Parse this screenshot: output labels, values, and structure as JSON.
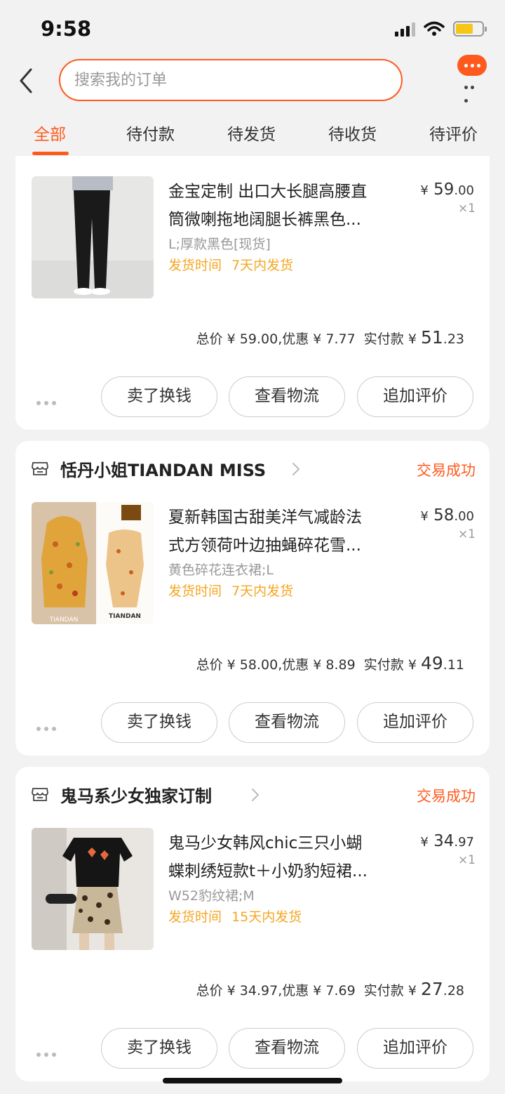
{
  "status_bar": {
    "time": "9:58"
  },
  "header": {
    "search_placeholder": "搜索我的订单",
    "tabs": [
      {
        "label": "全部",
        "active": true
      },
      {
        "label": "待付款",
        "active": false
      },
      {
        "label": "待发货",
        "active": false
      },
      {
        "label": "待收货",
        "active": false
      },
      {
        "label": "待评价",
        "active": false
      }
    ]
  },
  "orders": [
    {
      "shop_name": "",
      "status": "",
      "item": {
        "title_line1": "金宝定制 出口大长腿高腰直",
        "title_line2": "筒微喇拖地阔腿长裤黑色...",
        "sku": "L;厚款黑色[现货]",
        "ship_label": "发货时间",
        "ship_value": "7天内发货",
        "price_currency": "¥",
        "price_int": "59",
        "price_dec": ".00",
        "qty": "×1"
      },
      "summary": {
        "prefix": "总价 ¥ 59.00,优惠 ¥ 7.77",
        "paid_label": "实付款",
        "paid_currency": "¥",
        "paid_int": "51",
        "paid_dec": ".23"
      },
      "buttons": [
        "卖了换钱",
        "查看物流",
        "追加评价"
      ]
    },
    {
      "shop_name": "恬丹小姐TIANDAN MISS",
      "status": "交易成功",
      "item": {
        "title_line1": "夏新韩国古甜美洋气减龄法",
        "title_line2": "式方领荷叶边抽蝇碎花雪...",
        "sku": "黄色碎花连衣裙;L",
        "ship_label": "发货时间",
        "ship_value": "7天内发货",
        "price_currency": "¥",
        "price_int": "58",
        "price_dec": ".00",
        "qty": "×1"
      },
      "summary": {
        "prefix": "总价 ¥ 58.00,优惠 ¥ 8.89",
        "paid_label": "实付款",
        "paid_currency": "¥",
        "paid_int": "49",
        "paid_dec": ".11"
      },
      "buttons": [
        "卖了换钱",
        "查看物流",
        "追加评价"
      ],
      "thumb_text": [
        "TIANDAN",
        "TIANDAN"
      ]
    },
    {
      "shop_name": "鬼马系少女独家订制",
      "status": "交易成功",
      "item": {
        "title_line1": "鬼马少女韩风chic三只小蝴",
        "title_line2": "蝶刺绣短款t＋小奶豹短裙...",
        "sku": "W52豹纹裙;M",
        "ship_label": "发货时间",
        "ship_value": "15天内发货",
        "price_currency": "¥",
        "price_int": "34",
        "price_dec": ".97",
        "qty": "×1"
      },
      "summary": {
        "prefix": "总价 ¥ 34.97,优惠 ¥ 7.69",
        "paid_label": "实付款",
        "paid_currency": "¥",
        "paid_int": "27",
        "paid_dec": ".28"
      },
      "buttons": [
        "卖了换钱",
        "查看物流",
        "追加评价"
      ]
    }
  ],
  "colors": {
    "accent": "#ff5a1e",
    "ship_time": "#f5a623",
    "background": "#f2f2f2"
  }
}
